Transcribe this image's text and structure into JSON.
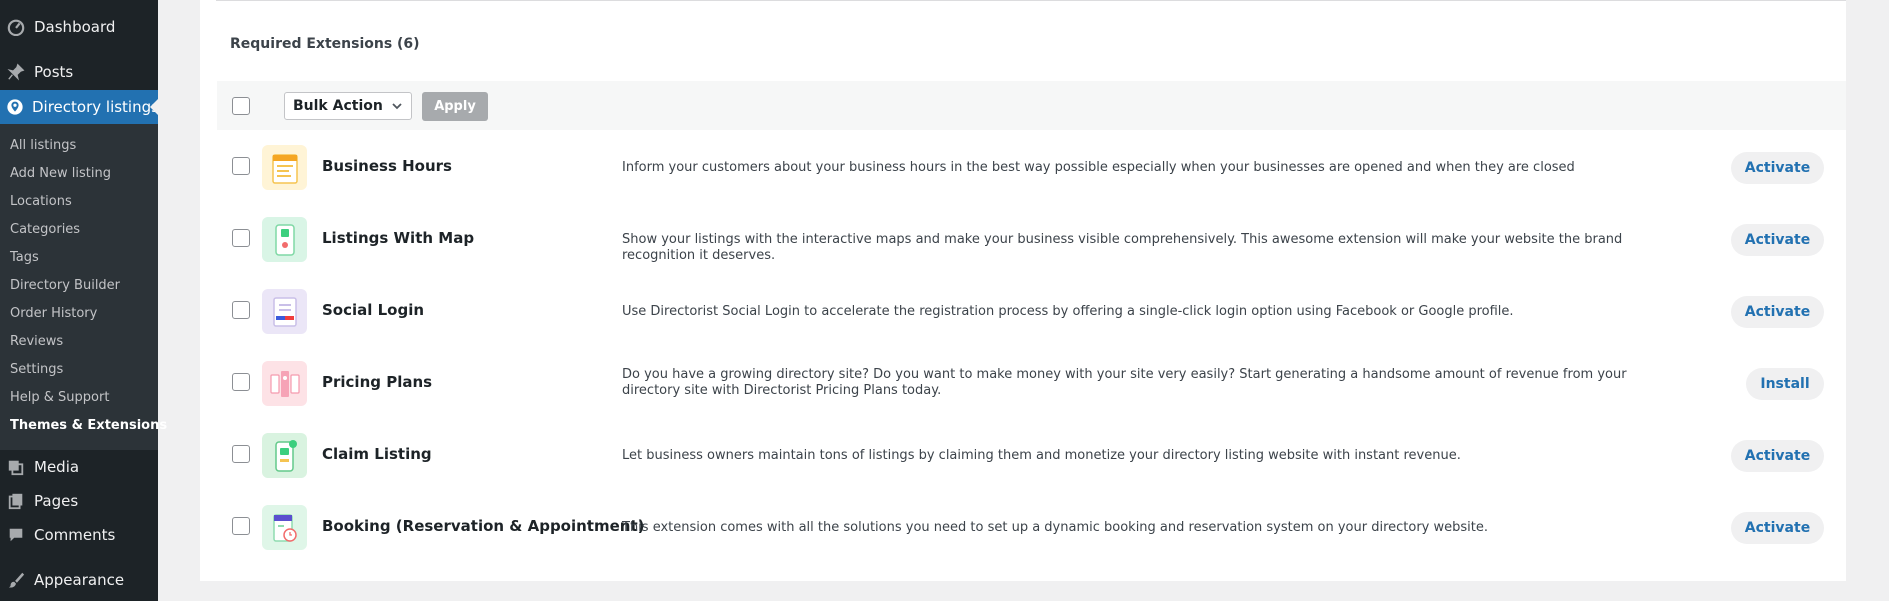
{
  "sidebar": {
    "menu": [
      {
        "label": "Dashboard",
        "icon": "dashboard-icon"
      },
      {
        "label": "Posts",
        "icon": "pin-icon"
      },
      {
        "label": "Directory listings",
        "icon": "directory-icon",
        "active": true
      },
      {
        "label": "Media",
        "icon": "media-icon"
      },
      {
        "label": "Pages",
        "icon": "pages-icon"
      },
      {
        "label": "Comments",
        "icon": "comments-icon"
      },
      {
        "label": "Appearance",
        "icon": "brush-icon"
      }
    ],
    "submenu": [
      "All listings",
      "Add New listing",
      "Locations",
      "Categories",
      "Tags",
      "Directory Builder",
      "Order History",
      "Reviews",
      "Settings",
      "Help & Support",
      "Themes & Extensions"
    ],
    "current_submenu": "Themes & Extensions"
  },
  "main": {
    "section_title": "Required Extensions (6)",
    "bulk_action": {
      "selected": "Bulk Action"
    },
    "apply_label": "Apply",
    "extensions": [
      {
        "name": "Business Hours",
        "description": "Inform your customers about your business hours in the best way possible especially when your businesses are opened and when they are closed",
        "action": "Activate",
        "thumb_bg": "#fff4d6"
      },
      {
        "name": "Listings With Map",
        "description": "Show your listings with the interactive maps and make your business visible comprehensively. This awesome extension will make your website the brand recognition it deserves.",
        "action": "Activate",
        "thumb_bg": "#d9f5e6"
      },
      {
        "name": "Social Login",
        "description": "Use Directorist Social Login to accelerate the registration process by offering a single-click login option using Facebook or Google profile.",
        "action": "Activate",
        "thumb_bg": "#ebe6f7"
      },
      {
        "name": "Pricing Plans",
        "description": "Do you have a growing directory site? Do you want to make money with your site very easily? Start generating a handsome amount of revenue from your directory site with Directorist Pricing Plans today.",
        "action": "Install",
        "thumb_bg": "#fde2e6"
      },
      {
        "name": "Claim Listing",
        "description": "Let business owners maintain tons of listings by claiming them and monetize your directory listing website with instant revenue.",
        "action": "Activate",
        "thumb_bg": "#d9f3e0"
      },
      {
        "name": "Booking (Reservation & Appointment)",
        "description": "This extension comes with all the solutions you need to set up a dynamic booking and reservation system on your directory website.",
        "action": "Activate",
        "thumb_bg": "#dff6e8"
      }
    ]
  },
  "colors": {
    "accent": "#2271b1",
    "sidebar_bg": "#1d2327"
  }
}
